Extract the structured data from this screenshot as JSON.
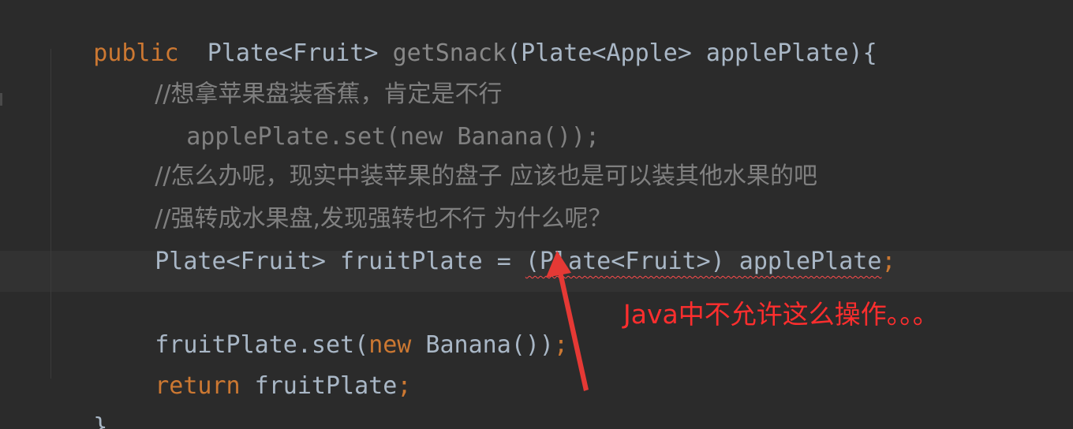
{
  "editor": {
    "background": "#2b2b2b",
    "lines": [
      {
        "tokens": [
          {
            "text": "public",
            "kind": "keyword"
          },
          {
            "text": "  Plate<Fruit> ",
            "kind": "text"
          },
          {
            "text": "getSnack",
            "kind": "function"
          },
          {
            "text": "(Plate<Apple> applePlate){",
            "kind": "text"
          }
        ]
      },
      {
        "tokens": [
          {
            "text": "//想拿苹果盘装香蕉，肯定是不行",
            "kind": "comment"
          }
        ]
      },
      {
        "tokens": [
          {
            "text": "applePlate.set(new Banana());",
            "kind": "comment"
          }
        ]
      },
      {
        "tokens": [
          {
            "text": "//怎么办呢，现实中装苹果的盘子 应该也是可以装其他水果的吧",
            "kind": "comment"
          }
        ]
      },
      {
        "tokens": [
          {
            "text": "//强转成水果盘,发现强转也不行 为什么呢？",
            "kind": "comment"
          }
        ]
      },
      {
        "tokens": [
          {
            "text": "Plate<Fruit> fruitPlate = ",
            "kind": "text"
          },
          {
            "text": "(Plate<Fruit>) applePlate",
            "kind": "error"
          },
          {
            "text": ";",
            "kind": "keyword"
          }
        ]
      },
      {
        "tokens": []
      },
      {
        "tokens": [
          {
            "text": "fruitPlate.set(",
            "kind": "text"
          },
          {
            "text": "new",
            "kind": "keyword"
          },
          {
            "text": " Banana())",
            "kind": "text"
          },
          {
            "text": ";",
            "kind": "keyword"
          }
        ]
      },
      {
        "tokens": [
          {
            "text": "return",
            "kind": "keyword"
          },
          {
            "text": " fruitPlate",
            "kind": "text"
          },
          {
            "text": ";",
            "kind": "keyword"
          }
        ]
      },
      {
        "tokens": [
          {
            "text": "}",
            "kind": "text"
          }
        ]
      }
    ]
  },
  "annotation": {
    "text": "Java中不允许这么操作。。。",
    "color": "#ff2e2e",
    "arrow_color": "#e53935"
  },
  "colors": {
    "keyword": "#cc7832",
    "function": "#888888",
    "comment": "#808080",
    "text": "#a9b7c6",
    "error_underline": "#ff4b4b"
  }
}
